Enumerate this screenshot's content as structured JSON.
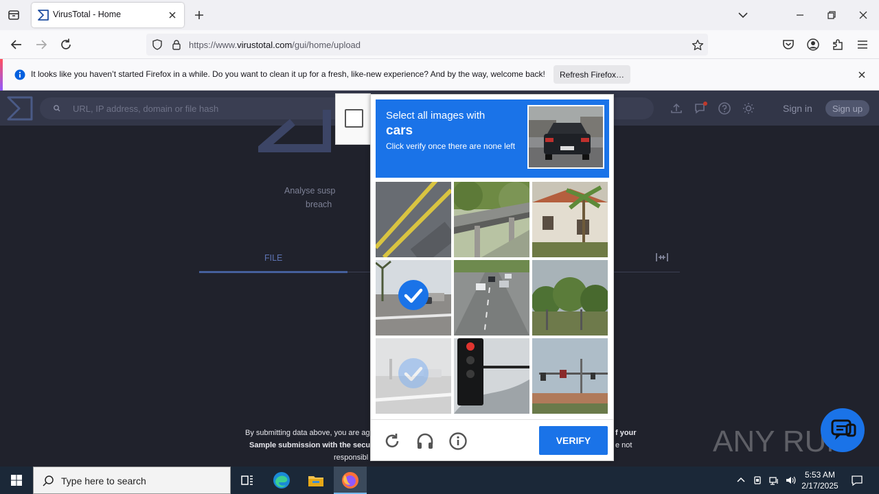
{
  "browser": {
    "tab_title": "VirusTotal - Home",
    "url_prefix": "https://www.",
    "url_domain": "virustotal.com",
    "url_path": "/gui/home/upload",
    "notification": {
      "message": "It looks like you haven’t started Firefox in a while. Do you want to clean it up for a fresh, like-new experience? And by the way, welcome back!",
      "button": "Refresh Firefox…"
    }
  },
  "vt": {
    "search_placeholder": "URL, IP address, domain or file hash",
    "sign_in": "Sign in",
    "sign_up": "Sign up",
    "desc_line1": "Analyse susp",
    "desc_line2": "breach",
    "tab_file": "FILE",
    "legal_line1": "By submitting data above, you are ag",
    "legal_line2": "Sample submission with the secur",
    "legal_line3": "responsibl",
    "legal_line1_right": "f your",
    "legal_line2_right": "e not"
  },
  "captcha": {
    "line1": "Select all images with",
    "target": "cars",
    "line3": "Click verify once there are none left",
    "verify": "VERIFY",
    "tiles": [
      {
        "scene": "road-lines",
        "selected": false
      },
      {
        "scene": "bridge",
        "selected": false
      },
      {
        "scene": "palms-building",
        "selected": false
      },
      {
        "scene": "street-intersection",
        "selected": true
      },
      {
        "scene": "highway-cars",
        "selected": false
      },
      {
        "scene": "trees",
        "selected": false
      },
      {
        "scene": "faded-street",
        "selected": true
      },
      {
        "scene": "traffic-light",
        "selected": false
      },
      {
        "scene": "traffic-signal-pole",
        "selected": false
      }
    ]
  },
  "watermark": "ANY RUN",
  "taskbar": {
    "search_text": "Type here to search",
    "time": "5:53 AM",
    "date": "2/17/2025"
  },
  "colors": {
    "captcha_blue": "#1a73e8",
    "vt_header": "#323648",
    "vt_bg": "#20222c"
  }
}
